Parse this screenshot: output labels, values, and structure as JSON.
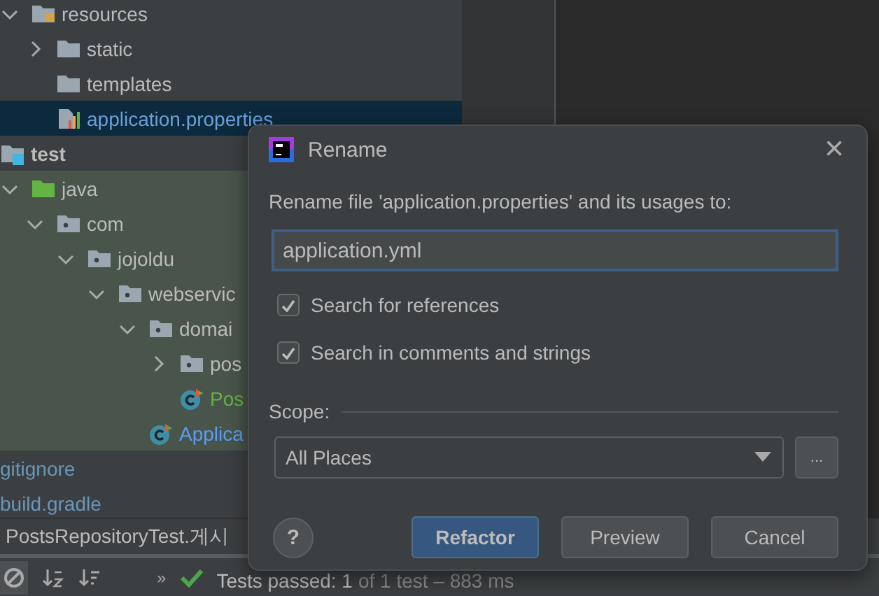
{
  "project_tree": [
    {
      "label": "resources",
      "kind": "resfolder",
      "expanded": true,
      "selected": false,
      "children": [
        {
          "label": "static",
          "kind": "folder",
          "expanded": false,
          "selected": false
        },
        {
          "label": "templates",
          "kind": "folder",
          "selected": false
        },
        {
          "label": "application.properties",
          "kind": "props",
          "selected": true
        }
      ]
    },
    {
      "label": "test",
      "kind": "testroot",
      "selected": false,
      "children": [
        {
          "label": "java",
          "kind": "greenfolder",
          "expanded": true,
          "selected": false,
          "children": [
            {
              "label": "com",
              "kind": "package",
              "expanded": true,
              "selected": false,
              "children": [
                {
                  "label": "jojoldu",
                  "kind": "package",
                  "expanded": true,
                  "selected": false,
                  "children": [
                    {
                      "label": "webservic",
                      "kind": "package",
                      "expanded": true,
                      "selected": false,
                      "children": [
                        {
                          "label": "domai",
                          "kind": "package",
                          "expanded": true,
                          "selected": false,
                          "children": [
                            {
                              "label": "pos",
                              "kind": "package",
                              "expanded": false,
                              "selected": false
                            },
                            {
                              "label": "Pos",
                              "kind": "testclass",
                              "selected": false
                            }
                          ]
                        },
                        {
                          "label": "Applica",
                          "kind": "class",
                          "selected": false
                        }
                      ]
                    }
                  ]
                }
              ]
            }
          ]
        }
      ]
    },
    {
      "label": "gitignore",
      "kind": "file",
      "selected": false
    },
    {
      "label": "build.gradle",
      "kind": "file",
      "selected": false
    }
  ],
  "run_tab": {
    "label": "PostsRepositoryTest.게시"
  },
  "run_toolbar": {
    "more": "»",
    "status_main": "Tests passed: 1",
    "status_rest": "of 1 test – 883 ms"
  },
  "dialog": {
    "title": "Rename",
    "close": "×",
    "prompt": "Rename file 'application.properties' and its usages to:",
    "value": "application.yml",
    "options": [
      {
        "label": "Search for references",
        "checked": true
      },
      {
        "label": "Search in comments and strings",
        "checked": true
      }
    ],
    "scope_label": "Scope:",
    "scope_value": "All Places",
    "browse": "...",
    "help": "?",
    "buttons": [
      {
        "label": "Refactor",
        "kind": "primary"
      },
      {
        "label": "Preview",
        "kind": "normal"
      },
      {
        "label": "Cancel",
        "kind": "normal"
      }
    ]
  }
}
